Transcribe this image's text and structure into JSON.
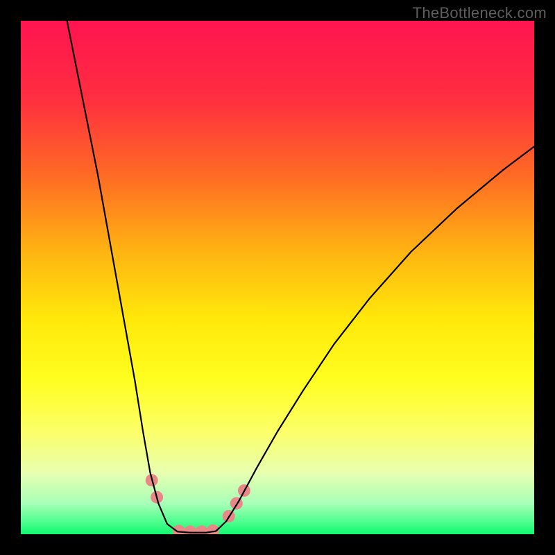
{
  "watermark": "TheBottleneck.com",
  "chart_data": {
    "type": "line",
    "title": "",
    "xlabel": "",
    "ylabel": "",
    "xlim": [
      0,
      100
    ],
    "ylim": [
      0,
      100
    ],
    "background_gradient": {
      "stops": [
        {
          "offset": 0.0,
          "color": "#ff1450"
        },
        {
          "offset": 0.15,
          "color": "#ff2e40"
        },
        {
          "offset": 0.3,
          "color": "#ff6a24"
        },
        {
          "offset": 0.45,
          "color": "#ffb412"
        },
        {
          "offset": 0.58,
          "color": "#ffe80a"
        },
        {
          "offset": 0.7,
          "color": "#fffe20"
        },
        {
          "offset": 0.8,
          "color": "#fcff68"
        },
        {
          "offset": 0.88,
          "color": "#e8ffb0"
        },
        {
          "offset": 0.94,
          "color": "#a8ffb8"
        },
        {
          "offset": 0.975,
          "color": "#50ff90"
        },
        {
          "offset": 1.0,
          "color": "#10f870"
        }
      ]
    },
    "series": [
      {
        "name": "bottleneck-curve-left",
        "type": "line",
        "color": "#000000",
        "points": [
          {
            "x": 9.0,
            "y": 100.0
          },
          {
            "x": 11.0,
            "y": 90.0
          },
          {
            "x": 13.0,
            "y": 80.0
          },
          {
            "x": 15.0,
            "y": 70.0
          },
          {
            "x": 16.8,
            "y": 60.0
          },
          {
            "x": 18.6,
            "y": 50.0
          },
          {
            "x": 20.4,
            "y": 40.0
          },
          {
            "x": 22.2,
            "y": 30.0
          },
          {
            "x": 23.8,
            "y": 20.0
          },
          {
            "x": 25.2,
            "y": 12.0
          },
          {
            "x": 26.8,
            "y": 6.0
          },
          {
            "x": 28.5,
            "y": 2.0
          },
          {
            "x": 30.5,
            "y": 0.5
          }
        ]
      },
      {
        "name": "bottleneck-curve-flat",
        "type": "line",
        "color": "#000000",
        "points": [
          {
            "x": 30.5,
            "y": 0.5
          },
          {
            "x": 33.0,
            "y": 0.3
          },
          {
            "x": 36.0,
            "y": 0.3
          },
          {
            "x": 38.0,
            "y": 0.6
          }
        ]
      },
      {
        "name": "bottleneck-curve-right",
        "type": "line",
        "color": "#000000",
        "points": [
          {
            "x": 38.0,
            "y": 0.6
          },
          {
            "x": 40.0,
            "y": 2.5
          },
          {
            "x": 42.5,
            "y": 6.5
          },
          {
            "x": 46.0,
            "y": 13.0
          },
          {
            "x": 50.0,
            "y": 20.0
          },
          {
            "x": 55.0,
            "y": 28.0
          },
          {
            "x": 61.0,
            "y": 37.0
          },
          {
            "x": 68.0,
            "y": 46.0
          },
          {
            "x": 76.0,
            "y": 55.0
          },
          {
            "x": 85.0,
            "y": 63.5
          },
          {
            "x": 94.0,
            "y": 71.0
          },
          {
            "x": 100.0,
            "y": 75.5
          }
        ]
      }
    ],
    "markers": {
      "name": "highlight-dots",
      "color": "#e98888",
      "radius_px": 9,
      "points": [
        {
          "x": 25.5,
          "y": 10.5
        },
        {
          "x": 26.5,
          "y": 7.2
        },
        {
          "x": 30.8,
          "y": 0.6
        },
        {
          "x": 33.0,
          "y": 0.5
        },
        {
          "x": 35.2,
          "y": 0.5
        },
        {
          "x": 37.4,
          "y": 0.7
        },
        {
          "x": 40.5,
          "y": 3.5
        },
        {
          "x": 42.0,
          "y": 6.0
        },
        {
          "x": 43.5,
          "y": 8.5
        }
      ]
    }
  }
}
